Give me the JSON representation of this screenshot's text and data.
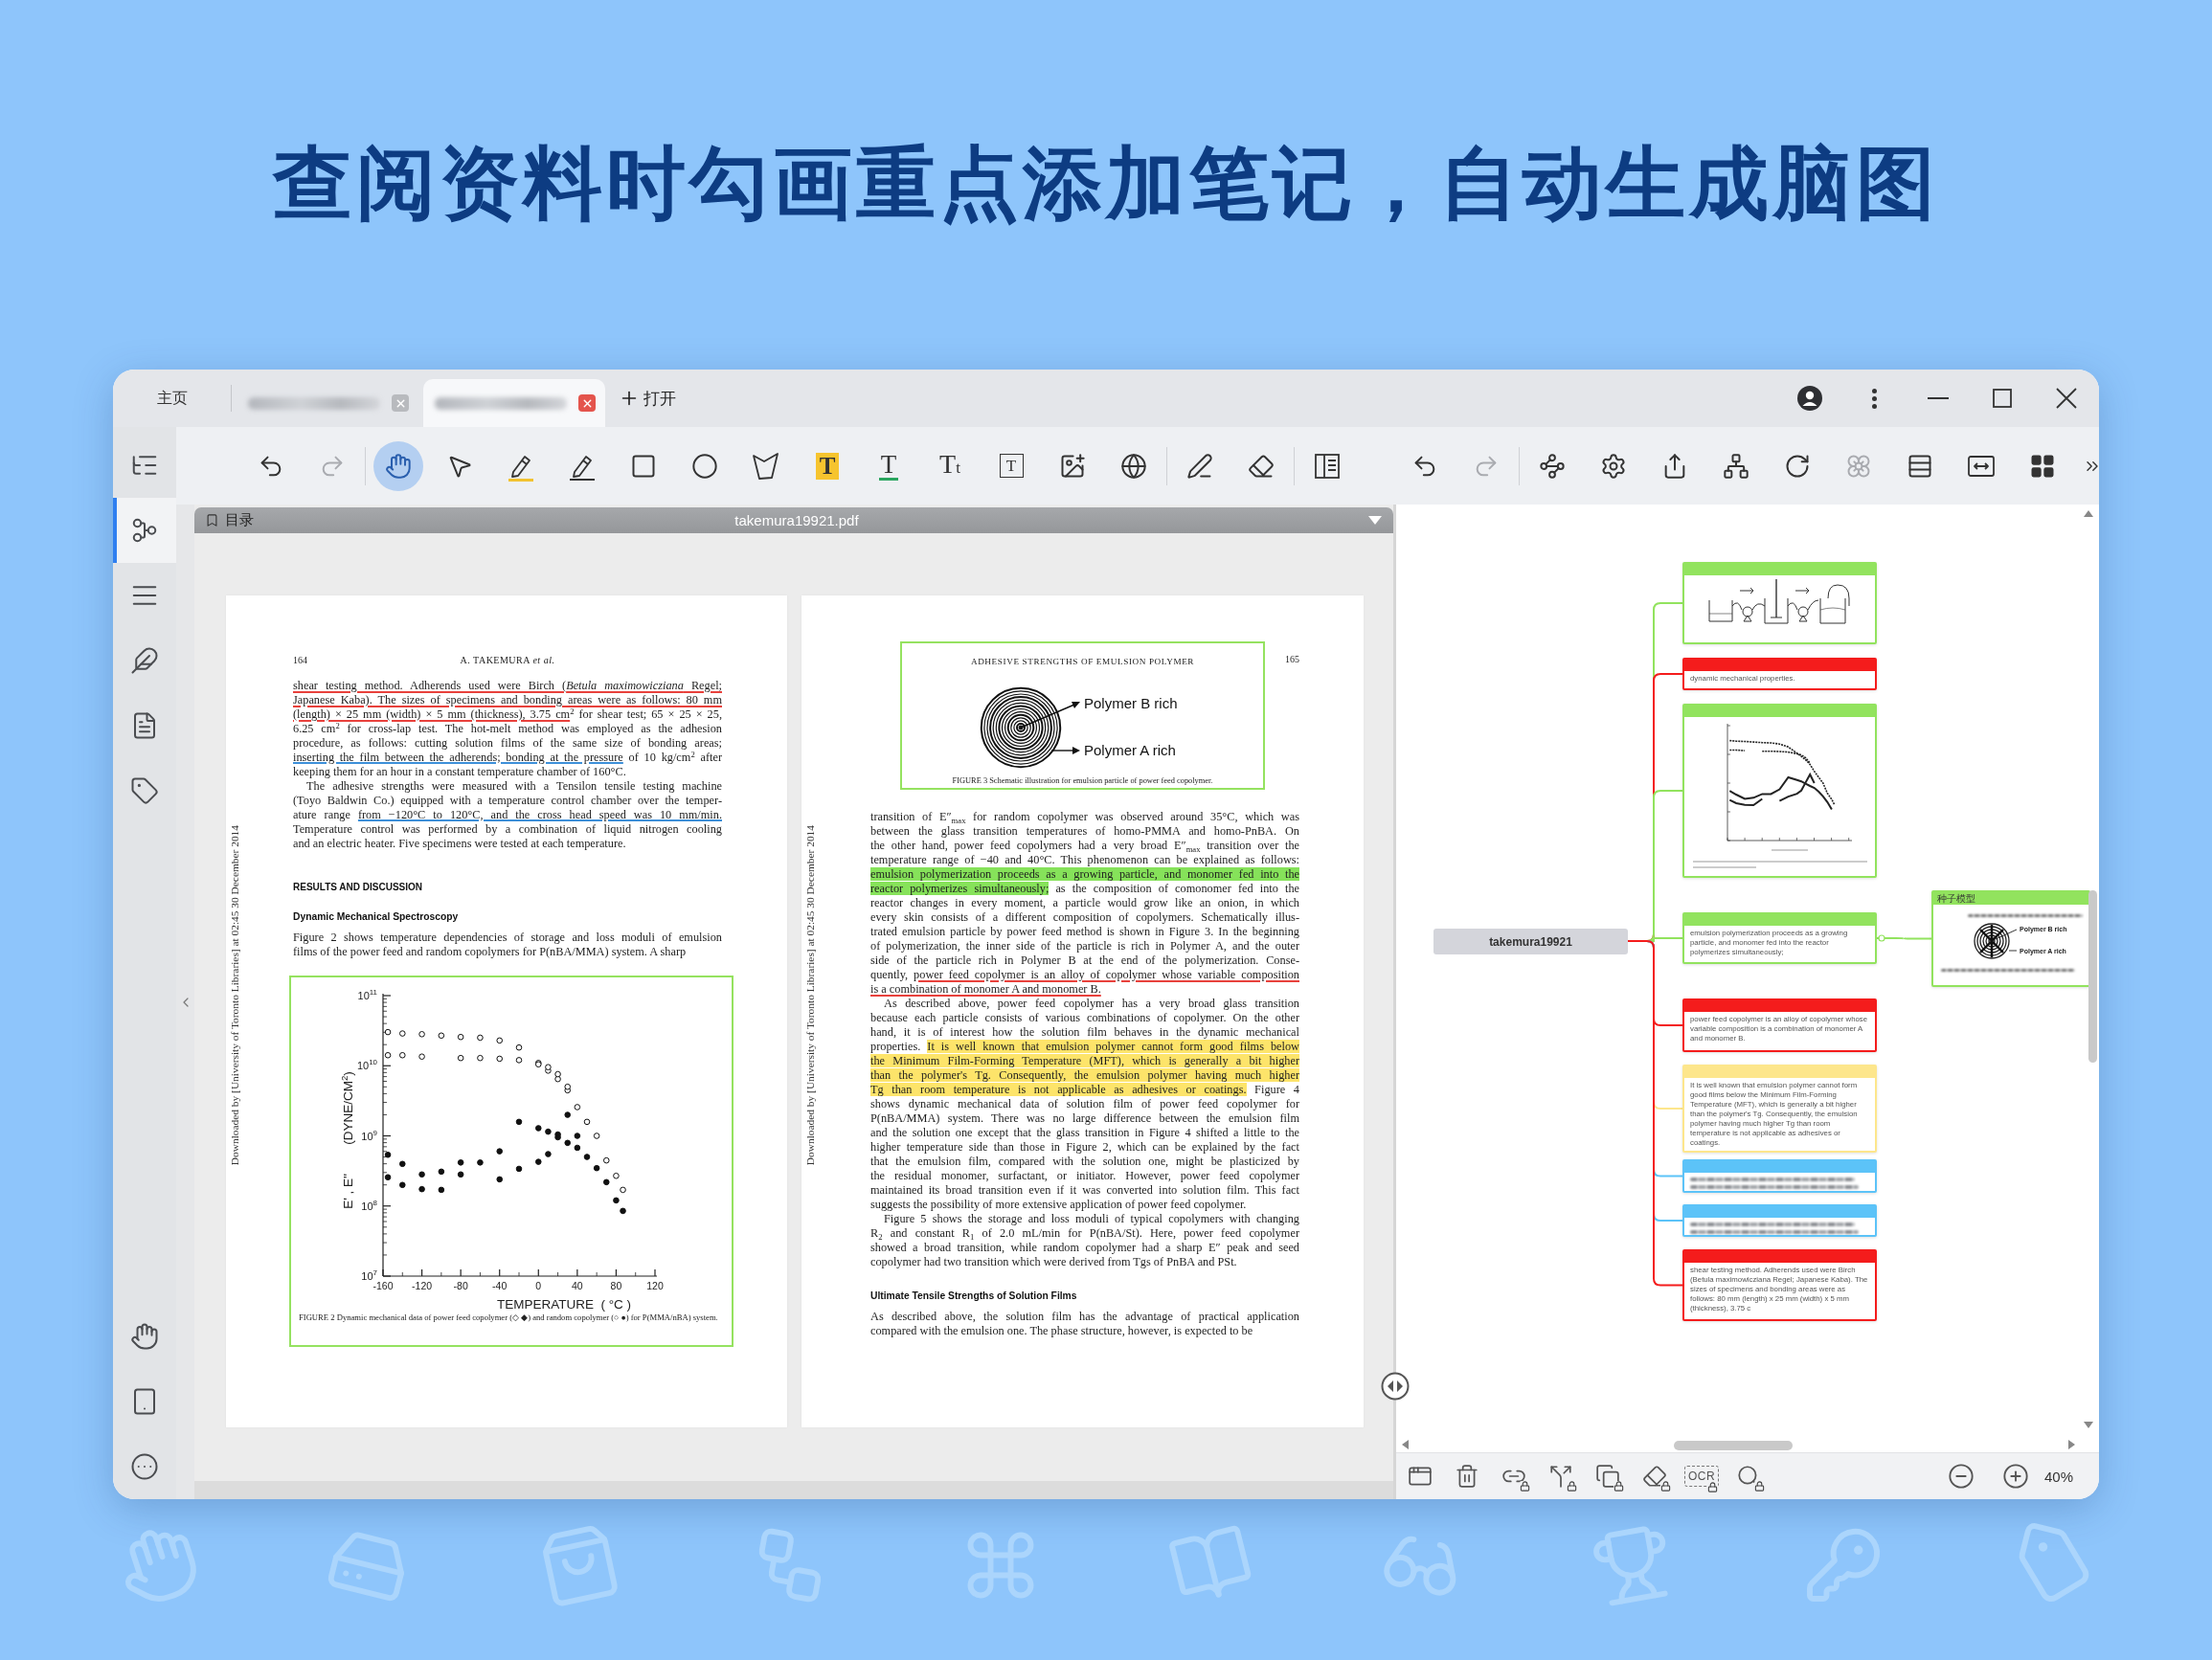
{
  "headline": "查阅资料时勾画重点添加笔记，自动生成脑图",
  "tabs": [
    {
      "kind": "home",
      "label": "主页",
      "selected": false
    },
    {
      "kind": "document",
      "selected": false
    },
    {
      "kind": "document",
      "selected": true
    }
  ],
  "open_button": {
    "label": "打开"
  },
  "sidebar": {
    "items": [
      {
        "kind": "outline",
        "selected": false
      },
      {
        "kind": "mind-map",
        "selected": true
      },
      {
        "kind": "list",
        "selected": false
      },
      {
        "kind": "notes",
        "selected": false
      },
      {
        "kind": "document",
        "selected": false
      },
      {
        "kind": "tags",
        "selected": false
      }
    ],
    "bottom_items": [
      {
        "kind": "gesture"
      },
      {
        "kind": "reader"
      },
      {
        "kind": "more"
      }
    ]
  },
  "pdf_tools": [
    [
      {
        "kind": "undo",
        "selected": false,
        "disabled": false
      },
      {
        "kind": "redo",
        "selected": false,
        "disabled": true
      }
    ],
    [
      {
        "kind": "hand",
        "selected": true,
        "disabled": false
      },
      {
        "kind": "pointer",
        "selected": false,
        "disabled": false
      },
      {
        "kind": "highlighter",
        "selected": false,
        "disabled": false
      },
      {
        "kind": "pencil",
        "selected": false,
        "disabled": false
      },
      {
        "kind": "rectangle",
        "selected": false,
        "disabled": false
      },
      {
        "kind": "ellipse",
        "selected": false,
        "disabled": false
      },
      {
        "kind": "polygon",
        "selected": false,
        "disabled": false
      },
      {
        "kind": "text-highlight",
        "glyph": "T",
        "selected": false,
        "disabled": false
      },
      {
        "kind": "text-underline",
        "glyph": "T",
        "selected": false,
        "disabled": false
      },
      {
        "kind": "text-size",
        "glyph": "Tt",
        "selected": false,
        "disabled": false
      },
      {
        "kind": "text-box",
        "glyph": "T",
        "selected": false,
        "disabled": false
      },
      {
        "kind": "image",
        "selected": false,
        "disabled": false
      },
      {
        "kind": "translate",
        "selected": false,
        "disabled": false
      }
    ],
    [
      {
        "kind": "signature",
        "selected": false,
        "disabled": false
      },
      {
        "kind": "eraser",
        "selected": false,
        "disabled": false
      }
    ],
    [
      {
        "kind": "split-view",
        "selected": false,
        "disabled": false
      }
    ]
  ],
  "map_tools": [
    [
      {
        "kind": "undo",
        "disabled": false
      },
      {
        "kind": "redo",
        "disabled": true
      }
    ],
    [
      {
        "kind": "structure",
        "disabled": false
      },
      {
        "kind": "settings",
        "disabled": false
      },
      {
        "kind": "export",
        "disabled": false
      },
      {
        "kind": "branch",
        "disabled": false
      },
      {
        "kind": "refresh",
        "disabled": false
      },
      {
        "kind": "flower",
        "disabled": true
      },
      {
        "kind": "layout",
        "disabled": false
      },
      {
        "kind": "fit-width",
        "disabled": false
      },
      {
        "kind": "grid",
        "disabled": false
      },
      {
        "kind": "more",
        "disabled": false
      }
    ]
  ],
  "pdf": {
    "toc_label": "目录",
    "file_name": "takemura19921.pdf",
    "pages": [
      {
        "margin_note": "Downloaded by [University of Toronto Libraries] at 02:45 30 December 2014",
        "blocks": [
          {
            "kind": "running-head",
            "number": "164",
            "text": "A. TAKEMURA *et al.*"
          },
          {
            "kind": "paragraph",
            "indent": false,
            "lines": [
              [
                {
                  "text": "shear testing method. Adherends used were Birch (*Betula maximowicziana* Regel;",
                  "kind": "red-underline"
                }
              ],
              [
                {
                  "text": "Japanese Kaba). The sizes of specimens and bonding areas were as follows: 80 mm",
                  "kind": "red-underline"
                }
              ],
              [
                {
                  "text": "(length) × 25 mm (width) × 5 mm (thickness), 3.75 cm",
                  "kind": "red-underline"
                },
                {
                  "text": "$^{2}$ for shear test; 65 × 25 × 25,",
                  "kind": "plain"
                }
              ],
              [
                {
                  "text": "6.25 cm$^{2}$ for cross-lap test. The hot-melt method was employed as the adhesion",
                  "kind": "plain"
                }
              ],
              [
                {
                  "text": "procedure, as follows: cutting solution films of the same size of bonding areas;",
                  "kind": "plain"
                }
              ],
              [
                {
                  "text": "inserting the film between the adherends; bonding at the pressure",
                  "kind": "blue-underline"
                },
                {
                  "text": " of 10 kg/cm$^{2}$ after",
                  "kind": "plain"
                }
              ],
              [
                {
                  "text": "keeping them for an hour in a constant temperature chamber of 160°C.",
                  "kind": "plain"
                }
              ]
            ]
          },
          {
            "kind": "paragraph",
            "indent": true,
            "lines": [
              [
                {
                  "text": "The adhesive strengths were measured with a Tensilon tensile testing machine",
                  "kind": "plain"
                }
              ],
              [
                {
                  "text": "(Toyo Baldwin Co.) equipped with a temperature control chamber over the temper-",
                  "kind": "plain"
                }
              ],
              [
                {
                  "text": "ature range ",
                  "kind": "plain"
                },
                {
                  "text": "from −120°C to 120°C, and the cross head speed was 10 mm/min.",
                  "kind": "blue-underline"
                }
              ],
              [
                {
                  "text": "Temperature control was performed by a combination of liquid nitrogen cooling",
                  "kind": "plain"
                }
              ],
              [
                {
                  "text": "and an electric heater. Five specimens were tested at each temperature.",
                  "kind": "plain"
                }
              ]
            ]
          },
          {
            "kind": "heading",
            "text": "RESULTS AND DISCUSSION"
          },
          {
            "kind": "subheading",
            "text": "Dynamic Mechanical Spectroscopy"
          },
          {
            "kind": "paragraph",
            "indent": false,
            "lines": [
              [
                {
                  "text": "Figure 2 shows temperature dependencies of storage and loss moduli of emulsion",
                  "kind": "plain"
                }
              ],
              [
                {
                  "text": "films of the power feed and random copolymers for P(nBA/MMA) system. A sharp",
                  "kind": "plain"
                }
              ]
            ]
          },
          {
            "kind": "boxed-plot",
            "x_axis_label": "TEMPERATURE  ( °C )",
            "y_axis_label": "E' , E''        (DYNE/CM$^{2}$)",
            "x_tick_labels": [
              "-160",
              "-120",
              "-80",
              "-40",
              "0",
              "40",
              "80",
              "120"
            ],
            "y_tick_labels": [
              "10$^{11}$",
              "10$^{10}$",
              "10$^{9}$",
              "10$^{8}$",
              "10$^{7}$"
            ],
            "caption": "FIGURE 2   Dynamic mechanical data of power feed copolymer (◇ ◆) and random copolymer (○ ●) for P(MMA/nBA) system."
          }
        ]
      },
      {
        "margin_note": "Downloaded by [University of Toronto Libraries] at 02:45 30 December 2014",
        "blocks": [
          {
            "kind": "boxed-figure",
            "running_head": "ADHESIVE STRENGTHS OF EMULSION POLYMER",
            "number": "165",
            "labels": [
              "Polymer B rich",
              "Polymer A rich"
            ],
            "caption": "FIGURE 3   Schematic illustration for emulsion particle of power feed copolymer."
          },
          {
            "kind": "paragraph",
            "indent": false,
            "lines": [
              [
                {
                  "text": "transition of E″$_{max}$ for random copolymer was observed around 35°C, which was",
                  "kind": "plain"
                }
              ],
              [
                {
                  "text": "between the glass transition temperatures of homo-PMMA and homo-PnBA. On",
                  "kind": "plain"
                }
              ],
              [
                {
                  "text": "the other hand, power feed copolymers had a very broad E″$_{max}$ transition over the",
                  "kind": "plain"
                }
              ],
              [
                {
                  "text": "temperature range of −40 and 40°C. This phenomenon can be explained as follows:",
                  "kind": "plain"
                }
              ],
              [
                {
                  "text": "emulsion polymerization proceeds as a growing particle, and monomer fed into the",
                  "kind": "green-highlight"
                }
              ],
              [
                {
                  "text": "reactor polymerizes simultaneously;",
                  "kind": "green-highlight"
                },
                {
                  "text": " as the composition of comonomer fed into the",
                  "kind": "plain"
                }
              ],
              [
                {
                  "text": "reactor changes in every moment, a particle would grow like an onion, in which",
                  "kind": "plain"
                }
              ],
              [
                {
                  "text": "every skin consists of a different composition of copolymers. Schematically illus-",
                  "kind": "plain"
                }
              ],
              [
                {
                  "text": "trated emulsion particle by power feed method is shown in Figure 3. In the beginning",
                  "kind": "plain"
                }
              ],
              [
                {
                  "text": "of polymerization, the inner side of the particle is rich in Polymer A, and the outer",
                  "kind": "plain"
                }
              ],
              [
                {
                  "text": "side of the particle rich in Polymer B at the end of the polymerization. Conse-",
                  "kind": "plain"
                }
              ],
              [
                {
                  "text": "quently, ",
                  "kind": "plain"
                },
                {
                  "text": "power feed copolymer is an alloy of copolymer whose variable composition",
                  "kind": "red-underline"
                }
              ],
              [
                {
                  "text": "is a combination of monomer A and monomer B.",
                  "kind": "red-underline"
                }
              ]
            ]
          },
          {
            "kind": "paragraph",
            "indent": true,
            "lines": [
              [
                {
                  "text": "As described above, power feed copolymer has a very broad glass transition",
                  "kind": "plain"
                }
              ],
              [
                {
                  "text": "because each particle consists of various combinations of copolymer. On the other",
                  "kind": "plain"
                }
              ],
              [
                {
                  "text": "hand, it is of interest how the solution film behaves in the dynamic mechanical",
                  "kind": "plain"
                }
              ],
              [
                {
                  "text": "properties. ",
                  "kind": "plain"
                },
                {
                  "text": "It is well known that emulsion polymer cannot form good films below",
                  "kind": "yellow-highlight"
                }
              ],
              [
                {
                  "text": "the Minimum Film-Forming Temperature (MFT), which is generally a bit higher",
                  "kind": "yellow-highlight"
                }
              ],
              [
                {
                  "text": "than the polymer's Tg. Consequently, the emulsion polymer having much higher",
                  "kind": "yellow-highlight"
                }
              ],
              [
                {
                  "text": "Tg than room temperature is not applicable as adhesives or coatings.",
                  "kind": "yellow-highlight"
                },
                {
                  "text": " Figure 4",
                  "kind": "plain"
                }
              ],
              [
                {
                  "text": "shows dynamic mechanical data of solution film of power feed copolymer for",
                  "kind": "plain"
                }
              ],
              [
                {
                  "text": "P(nBA/MMA) system. There was no large difference between the emulsion film",
                  "kind": "plain"
                }
              ],
              [
                {
                  "text": "and the solution one except that the glass transition in Figure 4 shifted a little to the",
                  "kind": "plain"
                }
              ],
              [
                {
                  "text": "higher temperature side than those in Figure 2, which can be explained by the fact",
                  "kind": "plain"
                }
              ],
              [
                {
                  "text": "that the emulsion film, compared with the solution one, might be plasticized by",
                  "kind": "plain"
                }
              ],
              [
                {
                  "text": "the residual monomer, surfactant, or initiator. However, power feed copolymer",
                  "kind": "plain"
                }
              ],
              [
                {
                  "text": "maintained its broad transition even if it was converted into solution film. This fact",
                  "kind": "plain"
                }
              ],
              [
                {
                  "text": "suggests the possibility of more extensive application of power feed copolymer.",
                  "kind": "plain"
                }
              ]
            ]
          },
          {
            "kind": "paragraph",
            "indent": true,
            "lines": [
              [
                {
                  "text": "Figure 5 shows the storage and loss moduli of typical copolymers with changing",
                  "kind": "plain"
                }
              ],
              [
                {
                  "text": "R$_{2}$ and constant R$_{1}$ of 2.0 mL/min for P(nBA/St). Here, power feed copolymer",
                  "kind": "plain"
                }
              ],
              [
                {
                  "text": "showed a broad transition, while random copolymer had a sharp E″ peak and seed",
                  "kind": "plain"
                }
              ],
              [
                {
                  "text": "copolymer had two transition which were derived from Tgs of PnBA and PSt.",
                  "kind": "plain"
                }
              ]
            ]
          },
          {
            "kind": "subheading",
            "text": "Ultimate Tensile Strengths of Solution Films"
          },
          {
            "kind": "paragraph",
            "indent": false,
            "lines": [
              [
                {
                  "text": "As described above, the solution film has the advantage of practical application",
                  "kind": "plain"
                }
              ],
              [
                {
                  "text": "compared with the emulsion one. The phase structure, however, is expected to be",
                  "kind": "plain"
                }
              ]
            ]
          }
        ]
      }
    ]
  },
  "mind_map": {
    "root": "takemura19921",
    "nodes": [
      {
        "kind": "apparatus-image",
        "color": "#92e35e"
      },
      {
        "kind": "text",
        "color": "#f41c1c",
        "text": "dynamic mechanical properties."
      },
      {
        "kind": "chart-image",
        "color": "#92e35e"
      },
      {
        "kind": "text",
        "color": "#92e35e",
        "text": "emulsion polymerization proceeds as a growing particle, and monomer fed into the reactor polymerizes simultaneously;",
        "children": [
          {
            "kind": "figure-image",
            "color": "#92e35e",
            "title": "种子模型",
            "labels": [
              "Polymer B rich",
              "Polymer A rich"
            ]
          }
        ]
      },
      {
        "kind": "text",
        "color": "#f41c1c",
        "text": "power feed copolymer is an alloy of copolymer whose variable composition is a combination of monomer A and monomer B."
      },
      {
        "kind": "text",
        "color": "#fde68c",
        "text": "It is well known that emulsion polymer cannot form good films below the Minimum Film-Forming Temperature (MFT), which is generally a bit higher than the polymer's Tg. Consequently, the emulsion polymer having much higher Tg than room temperature is not applicable as adhesives or coatings."
      },
      {
        "kind": "illegible-text",
        "color": "#5cc3f8"
      },
      {
        "kind": "illegible-text",
        "color": "#5cc3f8"
      },
      {
        "kind": "text",
        "color": "#f41c1c",
        "text": "shear testing method. Adherends used were Birch (Betula maximowicziana Regel; Japanese Kaba). The sizes of specimens and bonding areas were as follows: 80 mm (length) x 25 mm (width) x 5 mm (thickness), 3.75 c"
      }
    ],
    "bottom_tools": [
      {
        "kind": "frame",
        "locked": false
      },
      {
        "kind": "delete",
        "locked": false
      },
      {
        "kind": "link",
        "locked": true
      },
      {
        "kind": "branch",
        "locked": true
      },
      {
        "kind": "copy",
        "locked": true
      },
      {
        "kind": "erase",
        "locked": true
      },
      {
        "kind": "ocr",
        "label": "OCR",
        "locked": true
      },
      {
        "kind": "search",
        "locked": true
      }
    ],
    "zoom": "40%"
  }
}
